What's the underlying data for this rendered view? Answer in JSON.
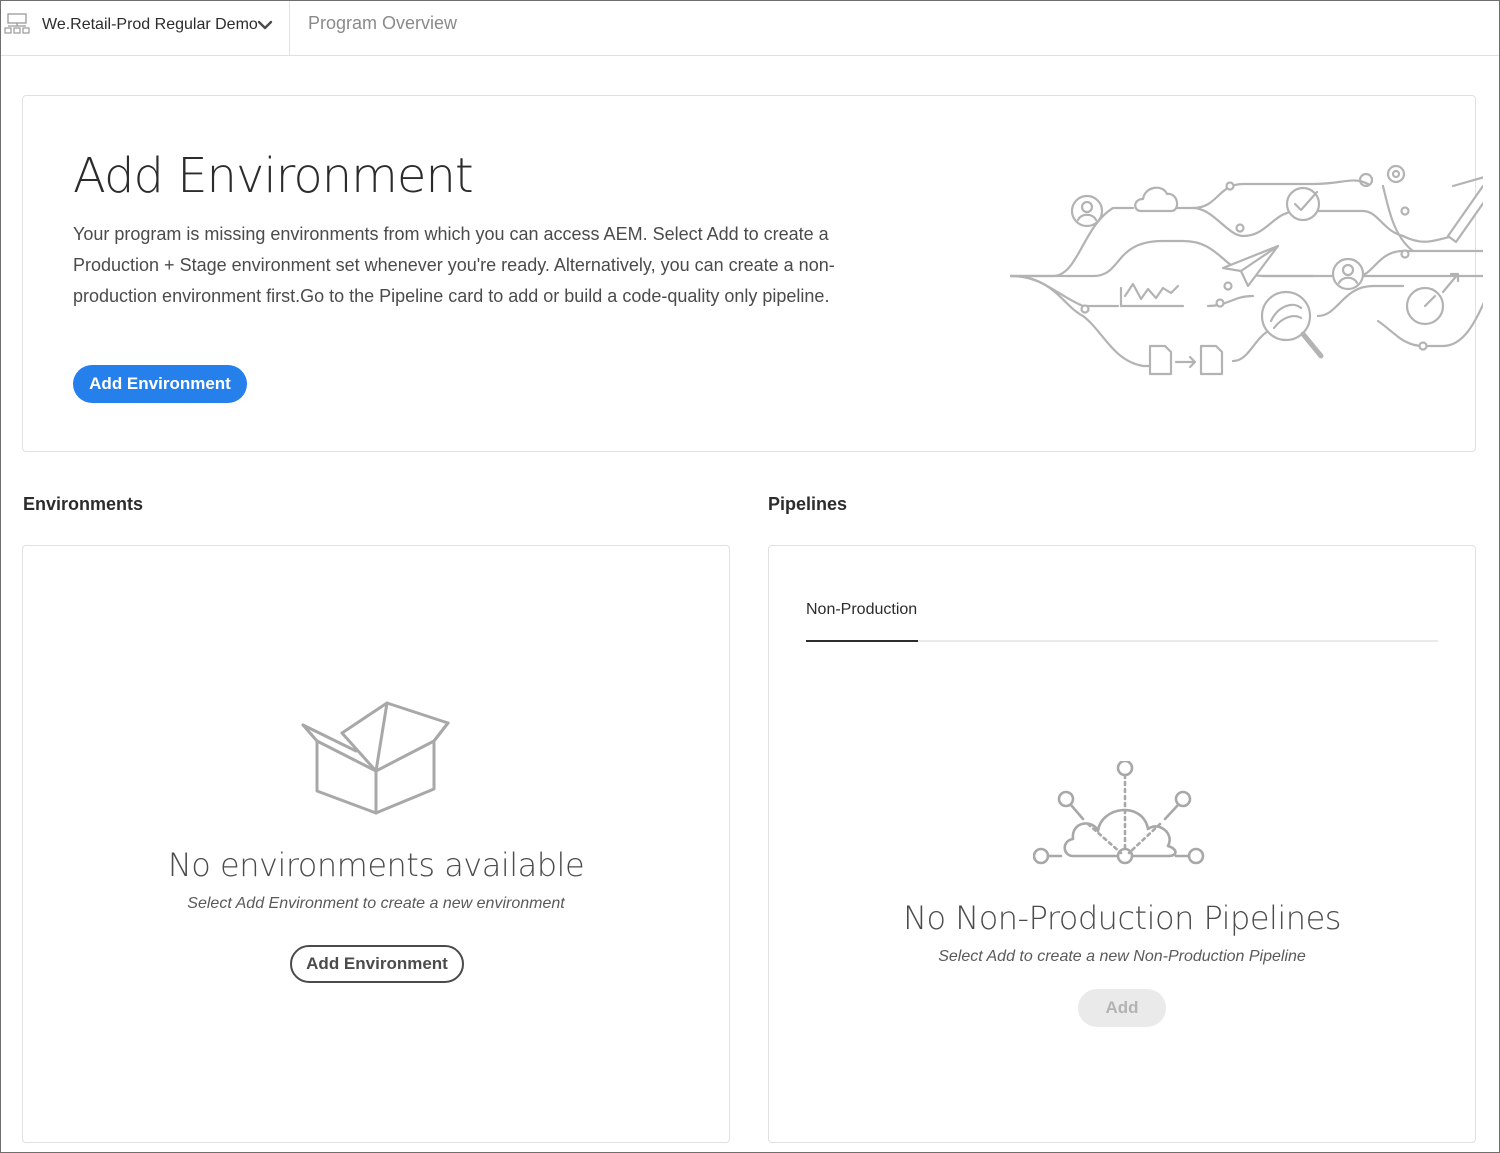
{
  "header": {
    "program_name": "We.Retail-Prod Regular Demo",
    "page_title": "Program Overview"
  },
  "hero": {
    "title": "Add Environment",
    "description": "Your program is missing environments from which you can access AEM. Select Add to create a Production + Stage environment set whenever you're ready. Alternatively, you can create a non-production environment first.Go to the Pipeline card to add or build a code-quality only pipeline.",
    "button_label": "Add Environment"
  },
  "environments": {
    "heading": "Environments",
    "empty_title": "No environments available",
    "empty_subtitle": "Select Add Environment to create a new environment",
    "button_label": "Add Environment"
  },
  "pipelines": {
    "heading": "Pipelines",
    "tabs": [
      {
        "label": "Non-Production",
        "selected": true
      }
    ],
    "empty_title": "No Non-Production Pipelines",
    "empty_subtitle": "Select Add to create a new Non-Production Pipeline",
    "button_label": "Add"
  },
  "colors": {
    "accent": "#2680eb",
    "border": "#e1e1e1",
    "icon_gray": "#a8a8a8"
  },
  "icons": [
    "program-switcher-icon",
    "chevron-down-icon",
    "hero-illustration",
    "empty-box-icon",
    "cloud-pipeline-icon"
  ]
}
